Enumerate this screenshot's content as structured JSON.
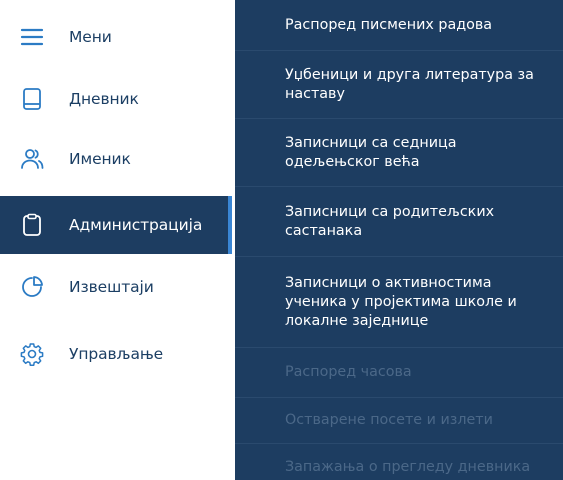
{
  "sidebar": {
    "items": [
      {
        "label": "Мени",
        "icon": "hamburger-menu-icon",
        "active": false
      },
      {
        "label": "Дневник",
        "icon": "book-icon",
        "active": false
      },
      {
        "label": "Именик",
        "icon": "people-icon",
        "active": false
      },
      {
        "label": "Администрација",
        "icon": "clipboard-icon",
        "active": true
      },
      {
        "label": "Извештаји",
        "icon": "pie-chart-icon",
        "active": false
      },
      {
        "label": "Управљање",
        "icon": "gear-icon",
        "active": false
      }
    ]
  },
  "submenu": {
    "items": [
      {
        "label": "Распоред писмених радова",
        "enabled": true
      },
      {
        "label": "Уџбеници и друга литература за наставу",
        "enabled": true
      },
      {
        "label": "Записници са седница одељењског већа",
        "enabled": true
      },
      {
        "label": "Записници са родитељских састанака",
        "enabled": true
      },
      {
        "label": "Записници о активностима ученика у пројектима школе и локалне заједнице",
        "enabled": true
      },
      {
        "label": "Распоред часова",
        "enabled": false
      },
      {
        "label": "Остварене посете и излети",
        "enabled": false
      },
      {
        "label": "Запажања о прегледу дневника",
        "enabled": false
      }
    ]
  },
  "colors": {
    "navy": "#1d3d61",
    "accent": "#3a86d4",
    "icon_stroke": "#2b7bc4",
    "text_dark": "#1c3f64",
    "disabled_text": "#4b6888"
  }
}
